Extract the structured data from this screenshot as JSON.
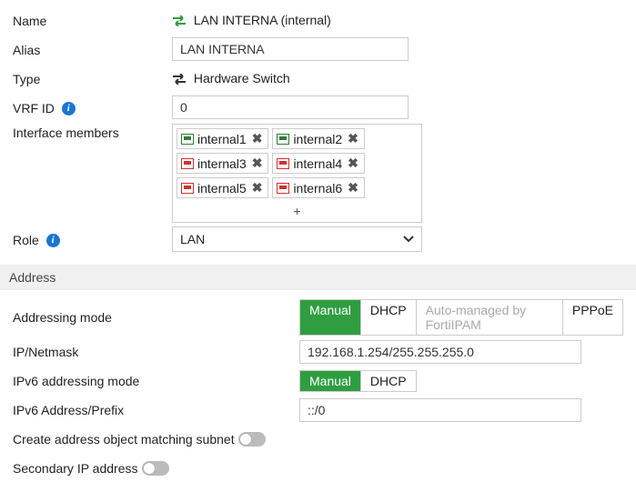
{
  "fields": {
    "name_label": "Name",
    "name_value": "LAN INTERNA (internal)",
    "alias_label": "Alias",
    "alias_value": "LAN INTERNA",
    "type_label": "Type",
    "type_value": "Hardware Switch",
    "vrf_label": "VRF ID",
    "vrf_value": "0",
    "members_label": "Interface members",
    "members": [
      {
        "name": "internal1",
        "status": "green"
      },
      {
        "name": "internal2",
        "status": "green"
      },
      {
        "name": "internal3",
        "status": "red"
      },
      {
        "name": "internal4",
        "status": "red"
      },
      {
        "name": "internal5",
        "status": "red"
      },
      {
        "name": "internal6",
        "status": "red"
      }
    ],
    "add_member_label": "+",
    "role_label": "Role",
    "role_value": "LAN"
  },
  "address": {
    "section_title": "Address",
    "addressing_mode_label": "Addressing mode",
    "addressing_opts": {
      "manual": "Manual",
      "dhcp": "DHCP",
      "auto": "Auto-managed by FortiIPAM",
      "pppoe": "PPPoE"
    },
    "ip_label": "IP/Netmask",
    "ip_value": "192.168.1.254/255.255.255.0",
    "v6mode_label": "IPv6 addressing mode",
    "v6mode_opts": {
      "manual": "Manual",
      "dhcp": "DHCP"
    },
    "v6addr_label": "IPv6 Address/Prefix",
    "v6addr_value": "::/0",
    "create_obj_label": "Create address object matching subnet",
    "secondary_label": "Secondary IP address"
  }
}
